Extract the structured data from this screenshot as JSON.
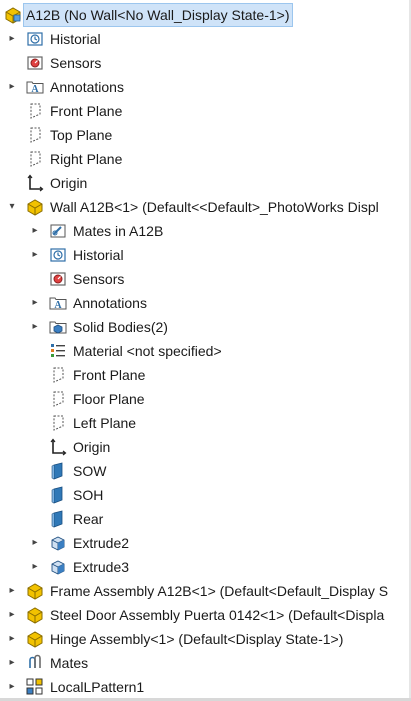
{
  "tree": {
    "root": {
      "label": "A12B  (No Wall<No Wall_Display State-1>)",
      "icon": "assembly-icon"
    },
    "items": [
      {
        "label": "Historial",
        "icon": "history-icon"
      },
      {
        "label": "Sensors",
        "icon": "sensor-icon"
      },
      {
        "label": "Annotations",
        "icon": "annotation-icon"
      },
      {
        "label": "Front Plane",
        "icon": "plane-icon"
      },
      {
        "label": "Top Plane",
        "icon": "plane-icon"
      },
      {
        "label": "Right Plane",
        "icon": "plane-icon"
      },
      {
        "label": "Origin",
        "icon": "origin-icon"
      },
      {
        "label": "Wall A12B<1> (Default<<Default>_PhotoWorks Displ",
        "icon": "subassembly-icon"
      },
      {
        "label": "Mates in A12B",
        "icon": "mates-folder-icon"
      },
      {
        "label": "Historial",
        "icon": "history-icon"
      },
      {
        "label": "Sensors",
        "icon": "sensor-icon"
      },
      {
        "label": "Annotations",
        "icon": "annotation-icon"
      },
      {
        "label": "Solid Bodies(2)",
        "icon": "solid-bodies-icon"
      },
      {
        "label": "Material <not specified>",
        "icon": "material-icon"
      },
      {
        "label": "Front Plane",
        "icon": "plane-icon"
      },
      {
        "label": "Floor Plane",
        "icon": "plane-icon"
      },
      {
        "label": "Left Plane",
        "icon": "plane-icon"
      },
      {
        "label": "Origin",
        "icon": "origin-icon"
      },
      {
        "label": "SOW",
        "icon": "blue-plane-icon"
      },
      {
        "label": "SOH",
        "icon": "blue-plane-icon"
      },
      {
        "label": "Rear",
        "icon": "blue-plane-icon"
      },
      {
        "label": "Extrude2",
        "icon": "extrude-icon"
      },
      {
        "label": "Extrude3",
        "icon": "extrude-icon"
      },
      {
        "label": "Frame Assembly A12B<1> (Default<Default_Display S",
        "icon": "subassembly-icon"
      },
      {
        "label": "Steel Door Assembly Puerta 0142<1> (Default<Displa",
        "icon": "subassembly-icon"
      },
      {
        "label": "Hinge Assembly<1> (Default<Display State-1>)",
        "icon": "subassembly-icon"
      },
      {
        "label": "Mates",
        "icon": "mates-icon"
      },
      {
        "label": "LocalLPattern1",
        "icon": "pattern-icon"
      }
    ]
  },
  "colors": {
    "selection": "#cfe3f8",
    "assembly_yellow": "#f2c200",
    "blue_plane": "#2f78b7"
  }
}
